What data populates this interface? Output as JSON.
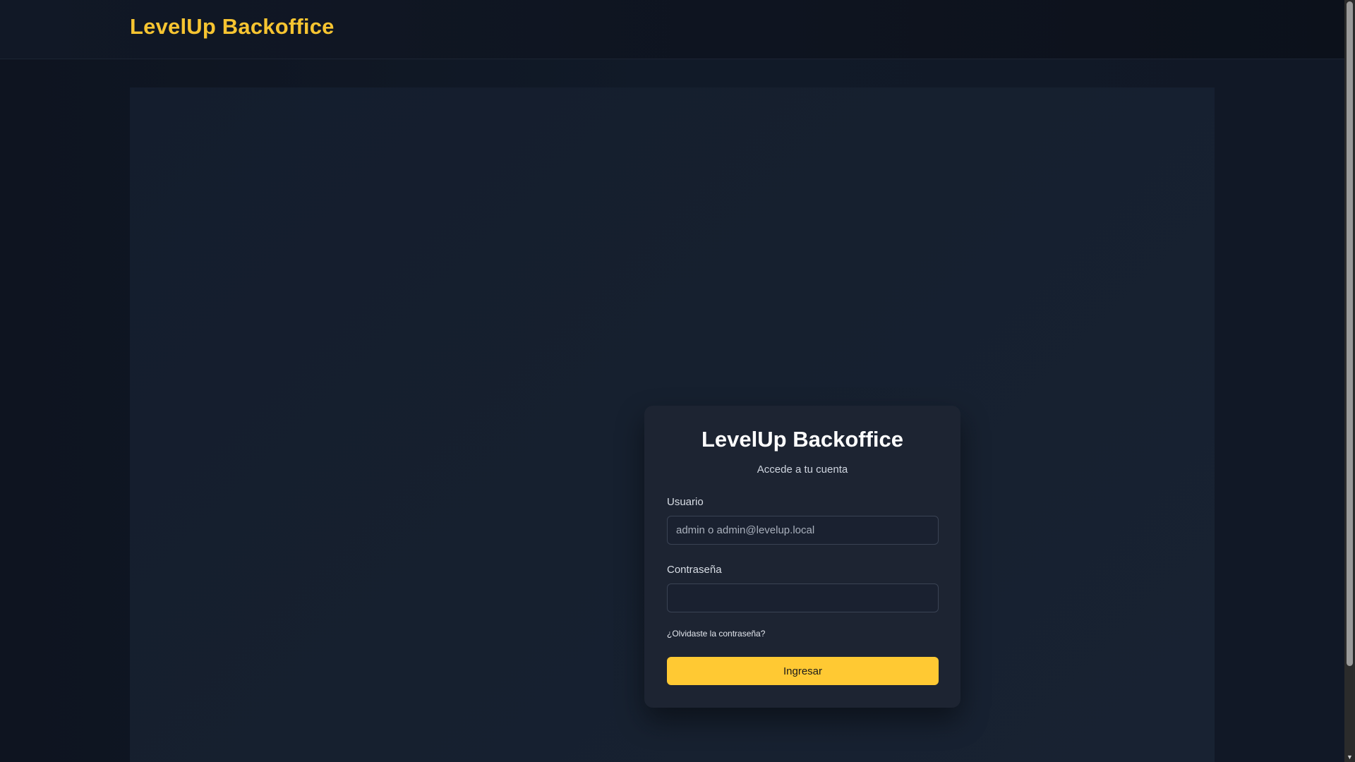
{
  "header": {
    "brand": "LevelUp Backoffice"
  },
  "login": {
    "title": "LevelUp Backoffice",
    "subtitle": "Accede a tu cuenta",
    "username_label": "Usuario",
    "username_placeholder": "admin o admin@levelup.local",
    "username_value": "",
    "password_label": "Contraseña",
    "password_value": "",
    "forgot_link": "¿Olvidaste la contraseña?",
    "submit_label": "Ingresar"
  },
  "colors": {
    "accent": "#ffc933",
    "brand_text": "#f6c431",
    "card_bg": "#1d2432",
    "page_bg": "#0f1623"
  },
  "icons": {
    "scroll_down": "chevron-down-icon"
  }
}
